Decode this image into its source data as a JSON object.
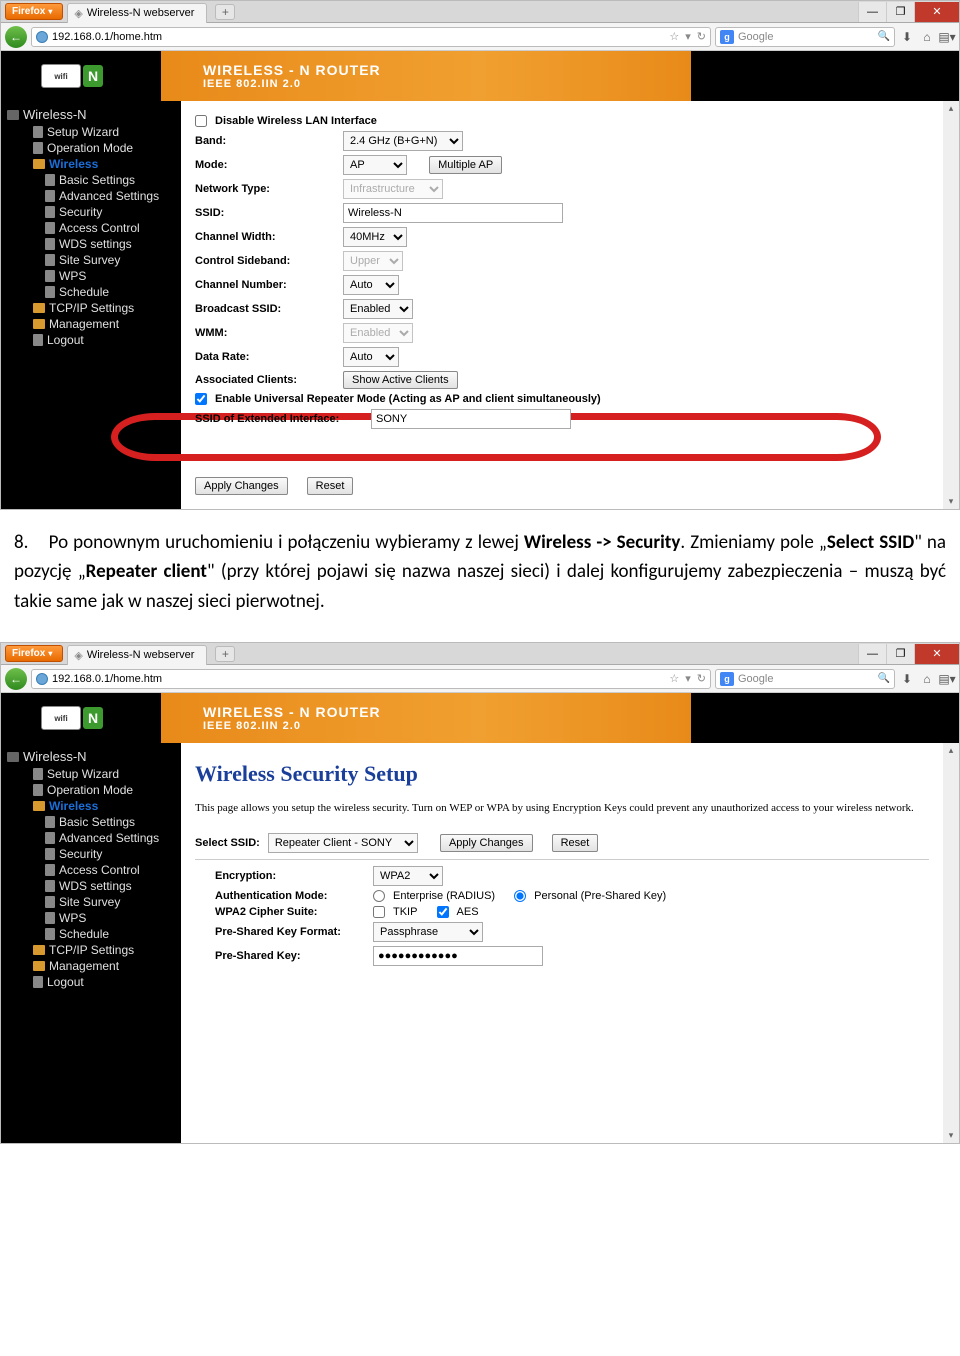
{
  "browser": {
    "name": "Firefox",
    "tab_title": "Wireless-N webserver",
    "url": "192.168.0.1/home.htm",
    "search_placeholder": "Google"
  },
  "window_controls": {
    "min": "—",
    "max": "❐",
    "close": "✕"
  },
  "router_header": {
    "line1": "WIRELESS - N ROUTER",
    "line2": "IEEE 802.IIN 2.0",
    "wifi": "wifi",
    "n": "N"
  },
  "sidebar": {
    "root": "Wireless-N",
    "items": [
      "Setup Wizard",
      "Operation Mode",
      "Wireless",
      "Basic Settings",
      "Advanced Settings",
      "Security",
      "Access Control",
      "WDS settings",
      "Site Survey",
      "WPS",
      "Schedule",
      "TCP/IP Settings",
      "Management",
      "Logout"
    ]
  },
  "screen1": {
    "disable_label": "Disable Wireless LAN Interface",
    "rows": {
      "band": {
        "label": "Band:",
        "value": "2.4 GHz (B+G+N)"
      },
      "mode": {
        "label": "Mode:",
        "value": "AP",
        "mbtn": "Multiple AP"
      },
      "network_type": {
        "label": "Network Type:",
        "value": "Infrastructure"
      },
      "ssid": {
        "label": "SSID:",
        "value": "Wireless-N"
      },
      "ch_width": {
        "label": "Channel Width:",
        "value": "40MHz"
      },
      "sideband": {
        "label": "Control Sideband:",
        "value": "Upper"
      },
      "ch_num": {
        "label": "Channel Number:",
        "value": "Auto"
      },
      "bcast": {
        "label": "Broadcast SSID:",
        "value": "Enabled"
      },
      "wmm": {
        "label": "WMM:",
        "value": "Enabled"
      },
      "rate": {
        "label": "Data Rate:",
        "value": "Auto"
      },
      "assoc": {
        "label": "Associated Clients:",
        "btn": "Show Active Clients"
      },
      "urm": "Enable Universal Repeater Mode (Acting as AP and client simultaneously)",
      "ext_ssid": {
        "label": "SSID of Extended Interface:",
        "value": "SONY"
      }
    },
    "apply": "Apply Changes",
    "reset": "Reset"
  },
  "paragraph": {
    "num": "8.",
    "text_a": "Po ponownym uruchomieniu i połączeniu wybieramy z lewej ",
    "b1": "Wireless -> Security",
    "text_b": ". Zmieniamy pole „",
    "b2": "Select SSID",
    "text_c": "\" na pozycję „",
    "b3": "Repeater client",
    "text_d": "\" (przy której pojawi się nazwa naszej sieci) i dalej konfigurujemy zabezpieczenia – muszą być takie same jak w naszej sieci pierwotnej."
  },
  "screen2": {
    "title": "Wireless Security Setup",
    "intro": "This page allows you setup the wireless security. Turn on WEP or WPA by using Encryption Keys could prevent any unauthorized access to your wireless network.",
    "select_ssid_label": "Select SSID:",
    "select_ssid_value": "Repeater Client - SONY",
    "apply": "Apply Changes",
    "reset": "Reset",
    "enc": {
      "label": "Encryption:",
      "value": "WPA2"
    },
    "auth": {
      "label": "Authentication Mode:",
      "r1": "Enterprise (RADIUS)",
      "r2": "Personal (Pre-Shared Key)"
    },
    "cipher": {
      "label": "WPA2 Cipher Suite:",
      "c1": "TKIP",
      "c2": "AES"
    },
    "pskfmt": {
      "label": "Pre-Shared Key Format:",
      "value": "Passphrase"
    },
    "psk": {
      "label": "Pre-Shared Key:",
      "value": "●●●●●●●●●●●●"
    }
  }
}
